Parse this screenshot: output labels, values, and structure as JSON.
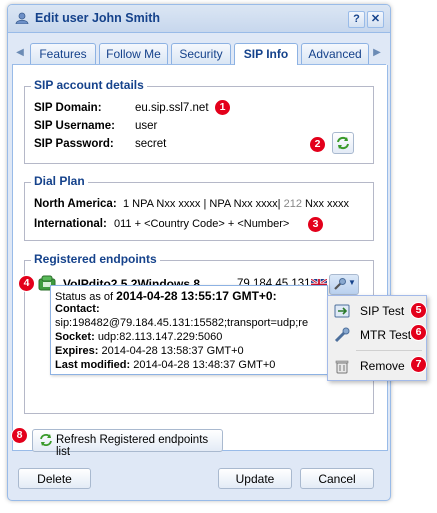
{
  "window": {
    "title": "Edit user John Smith",
    "help_label": "?",
    "close_label": "✕"
  },
  "tabs": [
    {
      "label": "Features",
      "active": false
    },
    {
      "label": "Follow Me",
      "active": false
    },
    {
      "label": "Security",
      "active": false
    },
    {
      "label": "SIP Info",
      "active": true
    },
    {
      "label": "Advanced",
      "active": false
    }
  ],
  "sip_account": {
    "legend": "SIP account details",
    "domain_label": "SIP Domain:",
    "domain_value": "eu.sip.ssl7.net",
    "username_label": "SIP Username:",
    "username_value": "user",
    "password_label": "SIP Password:",
    "password_value": "secret"
  },
  "dial_plan": {
    "legend": "Dial Plan",
    "north_america_label": "North America:",
    "north_america_value_a": "1 NPA Nxx xxxx | NPA Nxx xxxx|",
    "north_america_value_b": "212",
    "north_america_value_c": "Nxx xxxx",
    "international_label": "International:",
    "international_value": "011 + <Country Code> + <Number>"
  },
  "endpoints": {
    "legend": "Registered endpoints",
    "device_name": "VoIPdito2.5.2Windows 8",
    "device_ip": "79.184.45.131",
    "flag_icon": "uk-flag-icon"
  },
  "tooltip": {
    "status_prefix": "Status as of",
    "status_time": "2014-04-28 13:55:17 GMT+0:",
    "contact_label": "Contact:",
    "contact_value": "sip:198482@79.184.45.131:15582;transport=udp;re",
    "socket_label": "Socket:",
    "socket_value": "udp:82.113.147.229:5060",
    "expires_label": "Expires:",
    "expires_value": "2014-04-28 13:58:37 GMT+0",
    "modified_label": "Last modified:",
    "modified_value": "2014-04-28 13:48:37 GMT+0"
  },
  "context_menu": [
    {
      "label": "SIP Test",
      "icon": "sip-test-icon"
    },
    {
      "label": "MTR Test",
      "icon": "mtr-test-icon"
    },
    {
      "label": "Remove",
      "icon": "remove-icon"
    }
  ],
  "refresh_button_label": "Refresh Registered endpoints list",
  "footer": {
    "delete_label": "Delete",
    "update_label": "Update",
    "cancel_label": "Cancel"
  },
  "badges": [
    "1",
    "2",
    "3",
    "4",
    "5",
    "6",
    "7",
    "8"
  ],
  "colors": {
    "badge": "#e3001b",
    "window_border": "#99bbe8",
    "title_text": "#15428b"
  }
}
